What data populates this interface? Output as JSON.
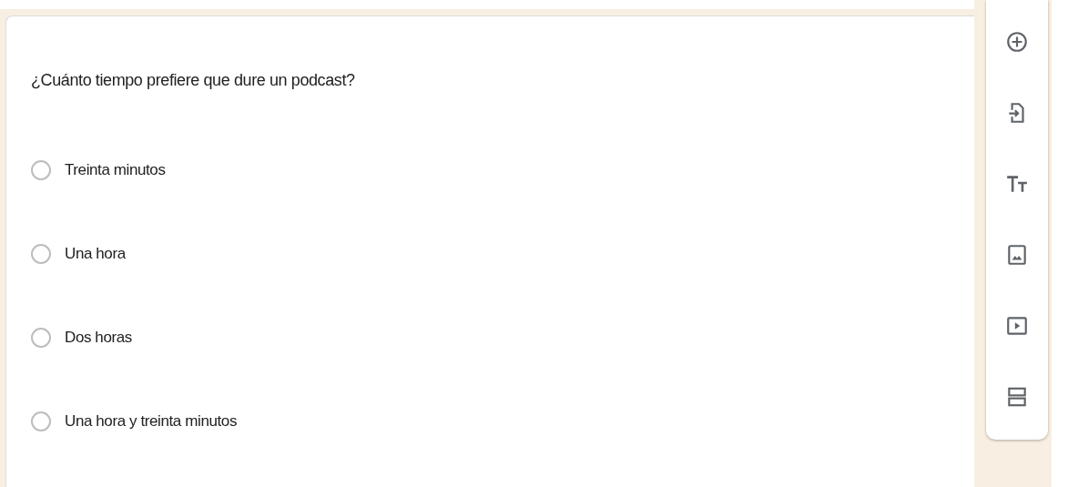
{
  "question": {
    "title": "¿Cuánto tiempo prefiere que dure un podcast?",
    "options": [
      {
        "label": "Treinta minutos",
        "selected": false
      },
      {
        "label": "Una hora",
        "selected": false
      },
      {
        "label": "Dos horas",
        "selected": false
      },
      {
        "label": "Una hora y treinta minutos",
        "selected": false
      }
    ]
  },
  "toolbar": {
    "tools": [
      {
        "kind": "add"
      },
      {
        "kind": "import"
      },
      {
        "kind": "title"
      },
      {
        "kind": "image"
      },
      {
        "kind": "video"
      },
      {
        "kind": "section"
      }
    ]
  }
}
